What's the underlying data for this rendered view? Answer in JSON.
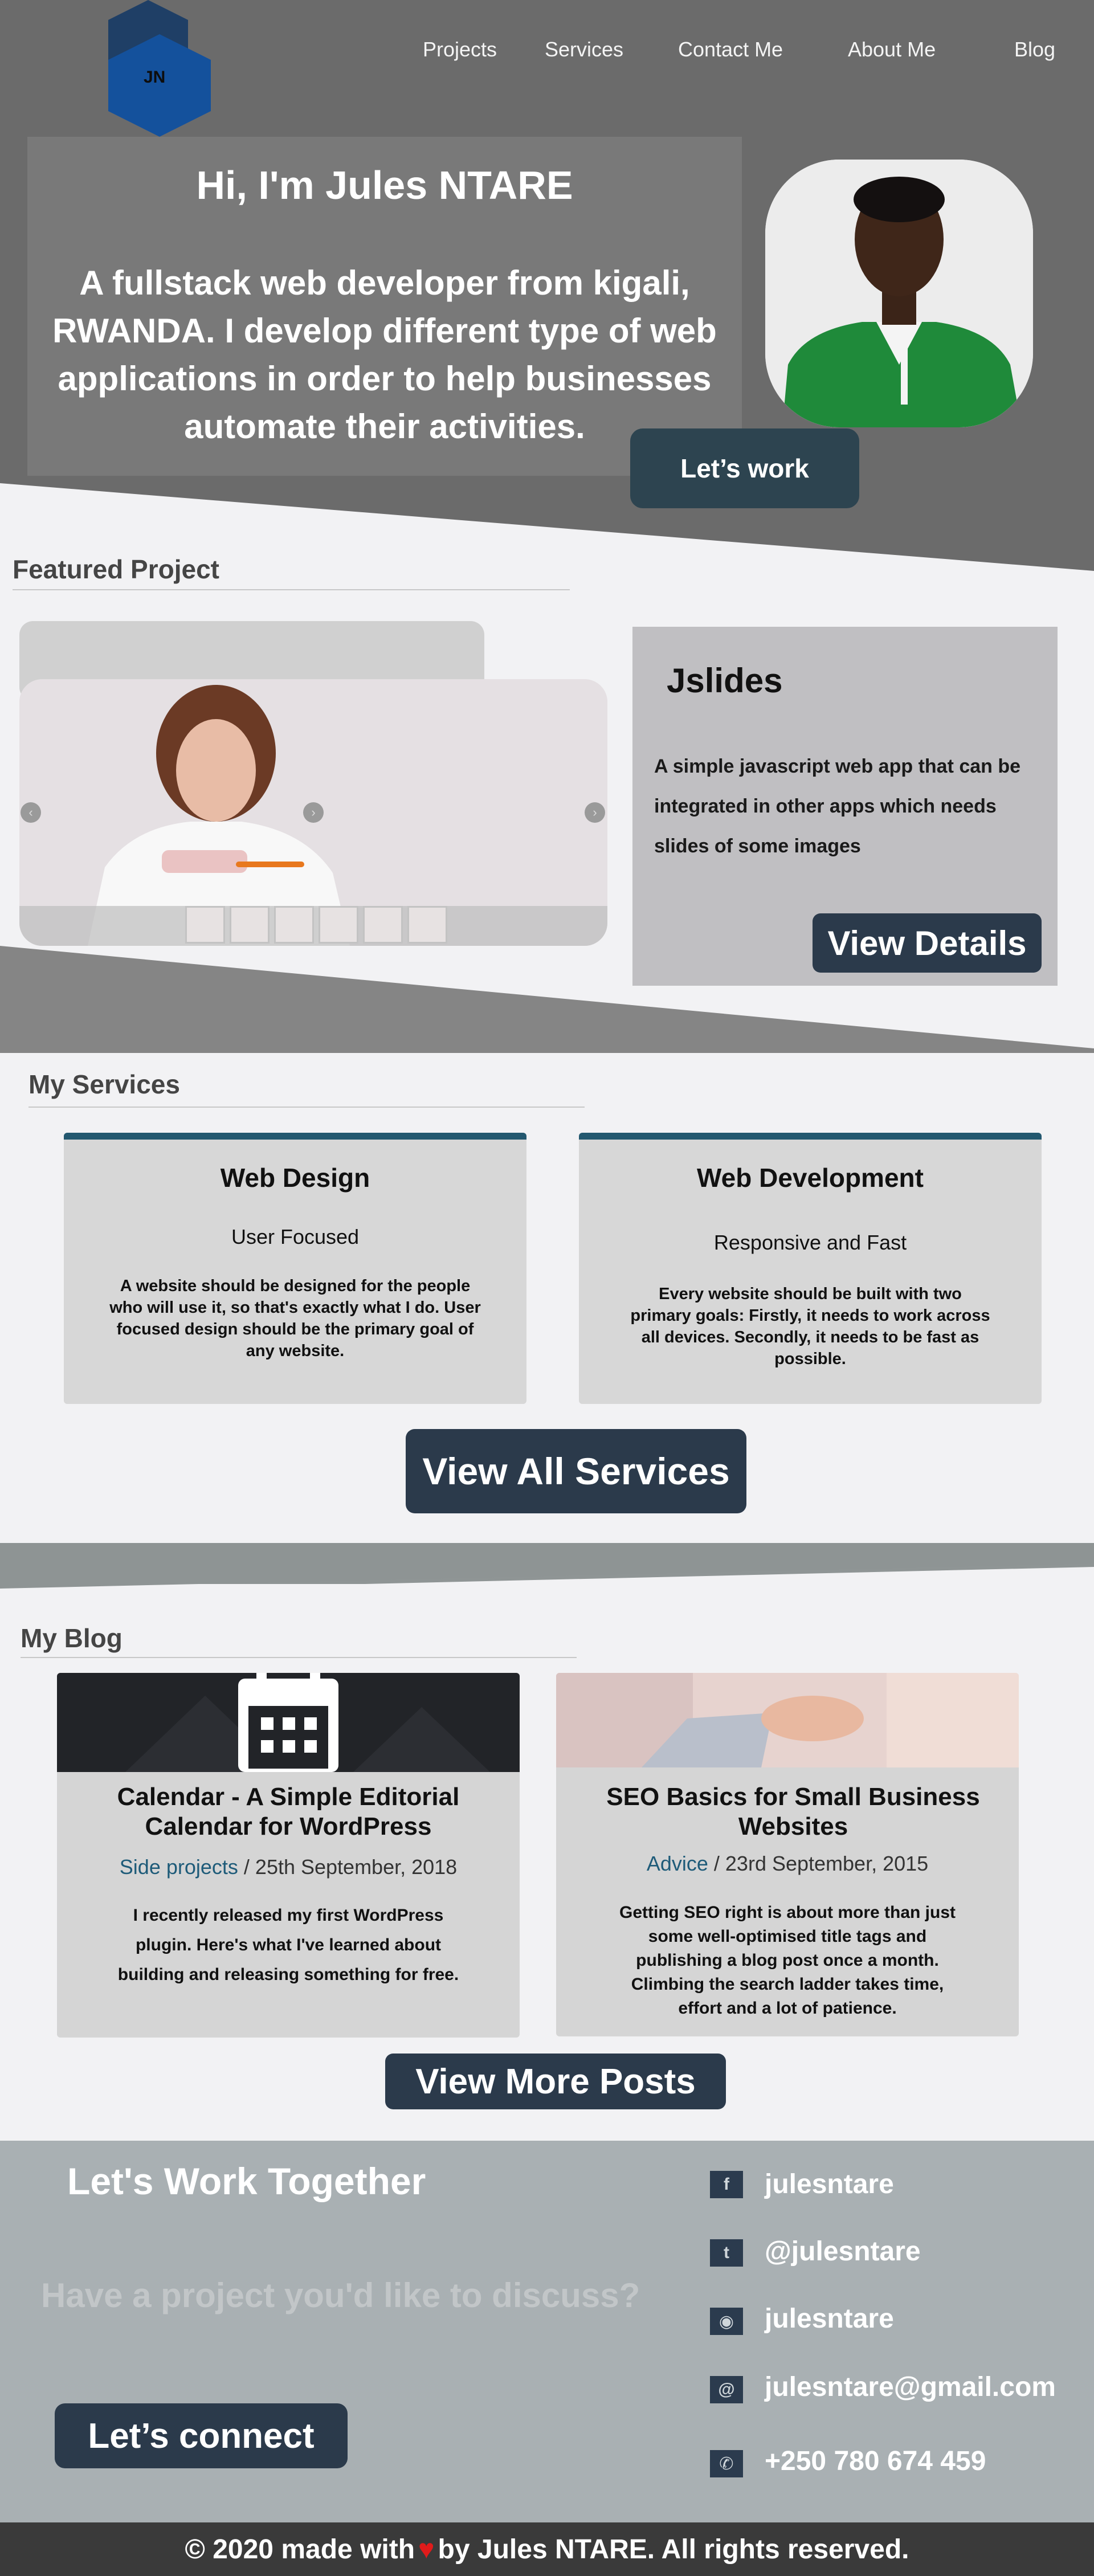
{
  "nav": {
    "logo_text": "JN",
    "items": [
      "Projects",
      "Services",
      "Contact Me",
      "About Me",
      "Blog"
    ]
  },
  "hero": {
    "greeting": "Hi, I'm Jules NTARE",
    "description": "A fullstack web developer from kigali, RWANDA. I develop different type of web applications in order to help businesses automate their activities.",
    "cta": "Let’s work"
  },
  "featured": {
    "section_title": "Featured Project",
    "project_title": "Jslides",
    "project_description": "A simple javascript web app that can be integrated in other apps which needs slides of some images",
    "details_button": "View Details"
  },
  "services": {
    "section_title": "My Services",
    "items": [
      {
        "title": "Web Design",
        "subtitle": "User Focused",
        "description": "A website should be designed for the people who will use it, so that's exactly what I do. User focused design should be the primary goal of any website."
      },
      {
        "title": "Web Development",
        "subtitle": "Responsive and Fast",
        "description": "Every website should be built with two primary goals: Firstly, it needs to work across all devices. Secondly, it needs to be fast as possible."
      }
    ],
    "all_button": "View All Services"
  },
  "blog": {
    "section_title": "My Blog",
    "posts": [
      {
        "title": "Calendar - A Simple Editorial Calendar for WordPress",
        "category": "Side projects",
        "date": "/ 25th September, 2018",
        "excerpt": "I recently released my first WordPress plugin. Here's what I've learned about building and releasing something for free."
      },
      {
        "title": "SEO Basics for Small Business Websites",
        "category": "Advice",
        "date": "/ 23rd September, 2015",
        "excerpt": "Getting SEO right is about more than just some well-optimised title tags and publishing a blog post once a month. Climbing the search ladder takes time, effort and a lot of patience."
      }
    ],
    "more_button": "View More Posts"
  },
  "contact": {
    "title": "Let's Work Together",
    "question": "Have a project you'd like to discuss?",
    "button": "Let’s connect",
    "socials": [
      {
        "icon": "facebook-icon",
        "glyph": "f",
        "text": "julesntare"
      },
      {
        "icon": "twitter-icon",
        "glyph": "t",
        "text": "@julesntare"
      },
      {
        "icon": "instagram-icon",
        "glyph": "◉",
        "text": "julesntare"
      },
      {
        "icon": "email-icon",
        "glyph": "@",
        "text": "julesntare@gmail.com"
      },
      {
        "icon": "whatsapp-icon",
        "glyph": "✆",
        "text": "+250 780 674 459"
      }
    ]
  },
  "footer": {
    "before_heart": "© 2020 made with",
    "heart": "♥",
    "after_heart": "by Jules NTARE. All rights reserved."
  },
  "colors": {
    "hero_bg": "#6b6b6b",
    "button": "#2b3a4b",
    "accent": "#23586f",
    "link": "#1e5b79",
    "footer_bg": "#3a3a3a"
  }
}
